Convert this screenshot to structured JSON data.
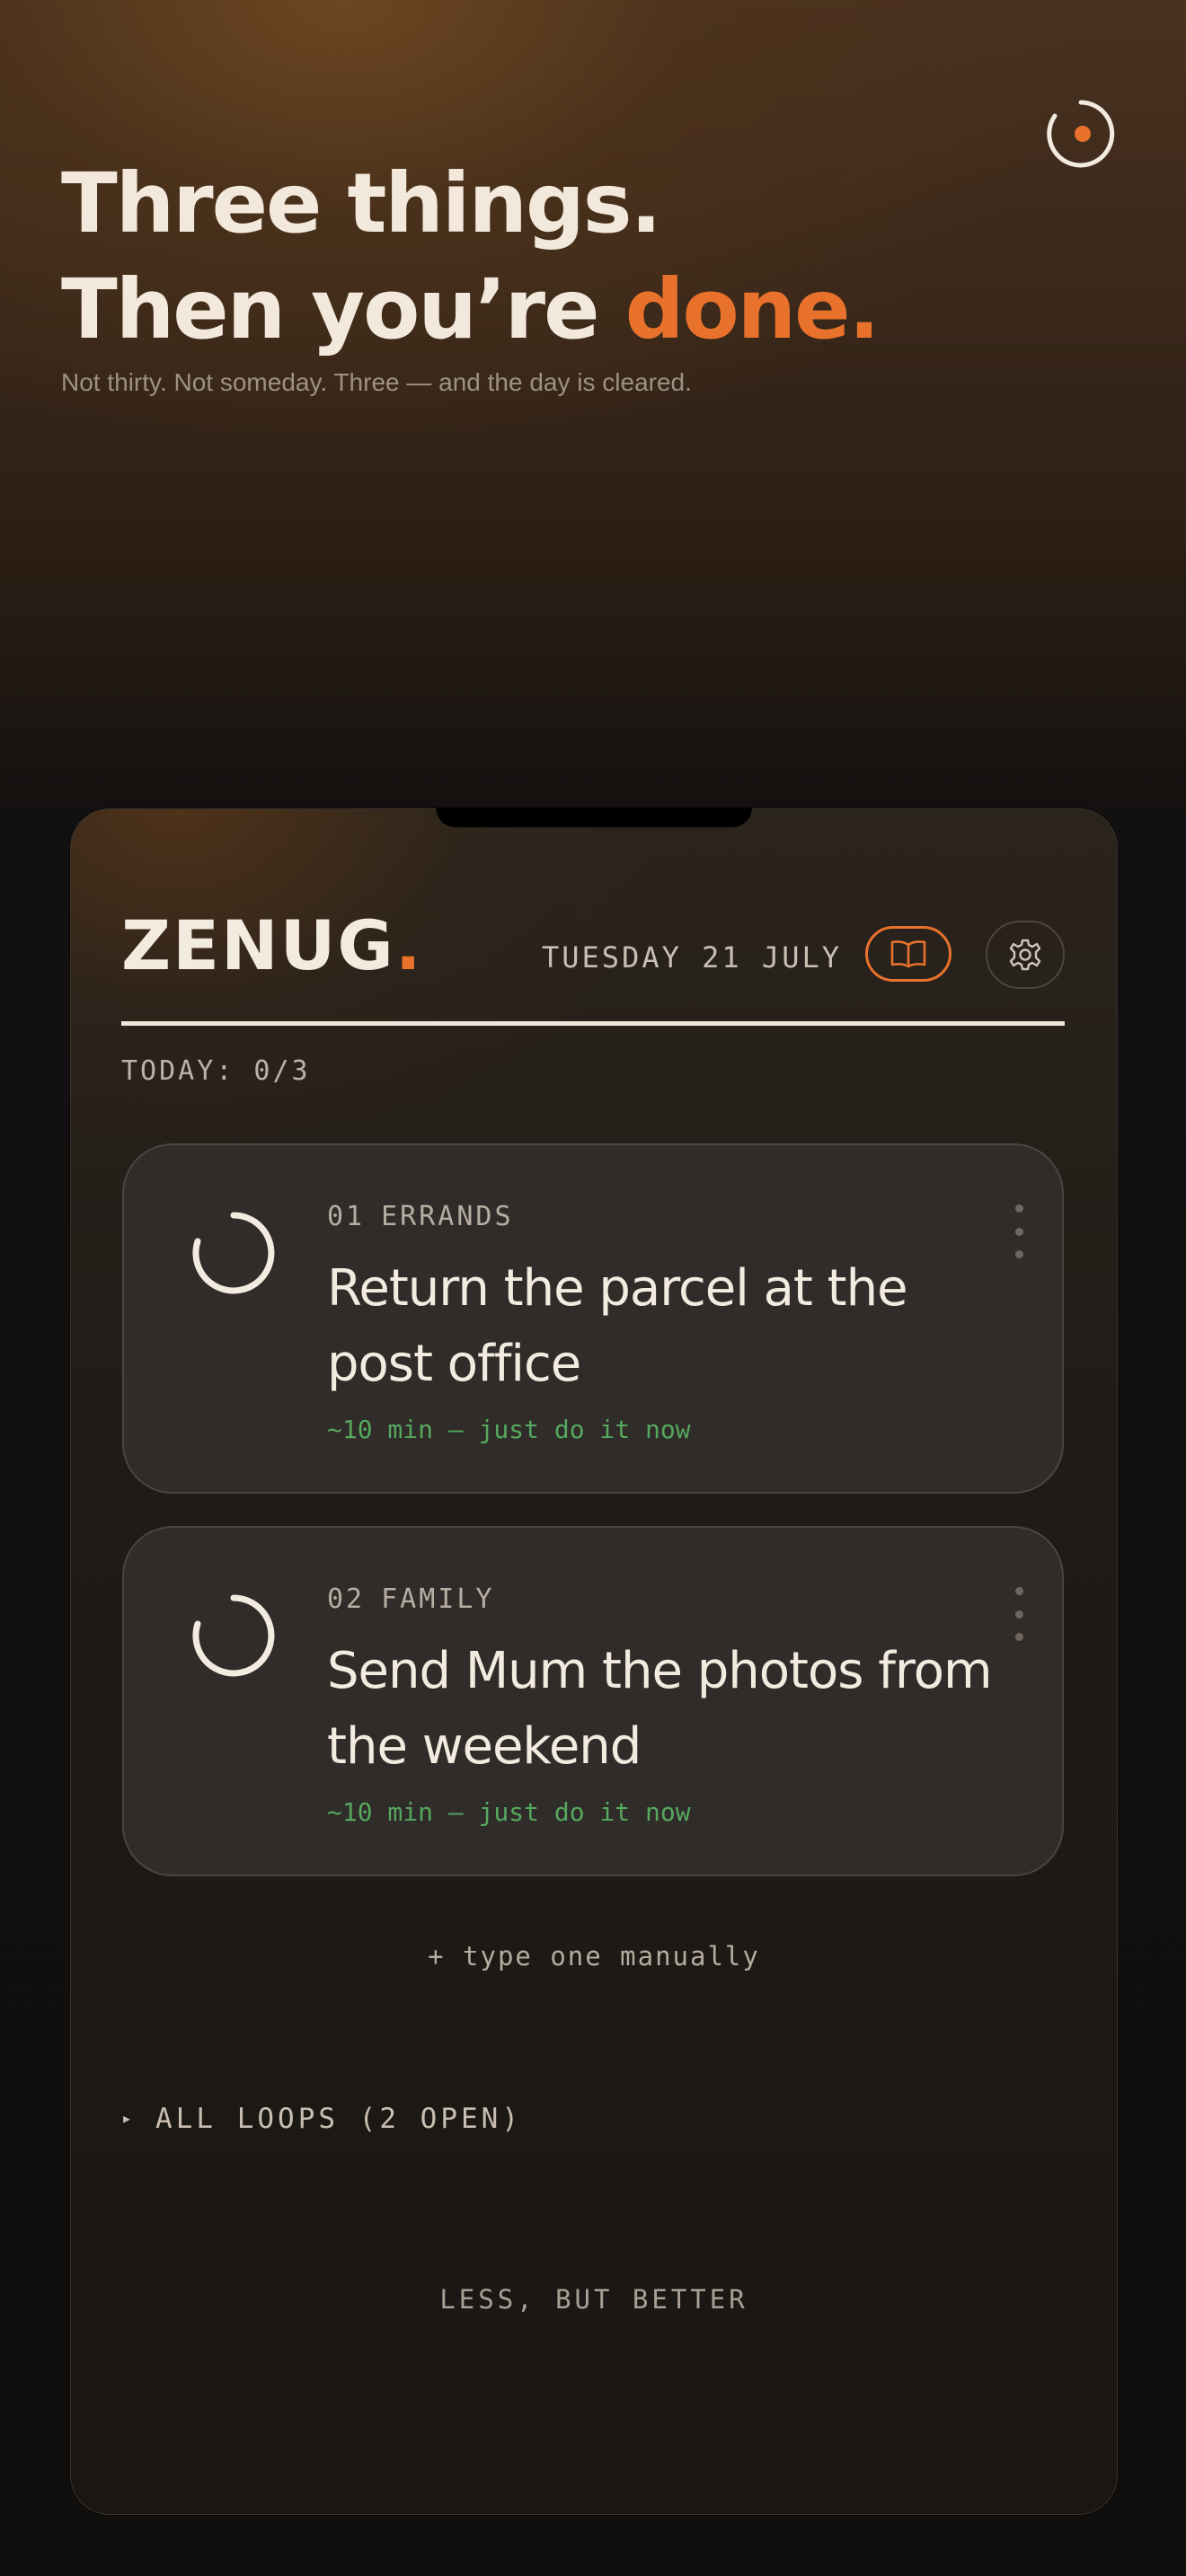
{
  "hero": {
    "line1": "Three things.",
    "line2_prefix": "Then you’re ",
    "line2_accent": "done.",
    "subtitle": "Not thirty. Not someday. Three — and the day is cleared."
  },
  "app": {
    "brand": "ZENUG",
    "brand_dot": ".",
    "date": "TUESDAY 21 JULY",
    "journal_icon": "book-icon",
    "settings_icon": "gear-icon",
    "progress": "TODAY: 0/3"
  },
  "tasks": [
    {
      "number": "01",
      "category": "ERRANDS",
      "title": "Return the parcel at the post office",
      "hint": "~10 min — just do it now"
    },
    {
      "number": "02",
      "category": "FAMILY",
      "title": "Send Mum the photos from the weekend",
      "hint": "~10 min — just do it now"
    }
  ],
  "actions": {
    "manual": "+ type one manually",
    "loops_arrow": "▸",
    "loops": "ALL LOOPS (2 OPEN)"
  },
  "footer": {
    "motto": "LESS, BUT BETTER"
  },
  "colors": {
    "accent": "#e8722c",
    "hint_green": "#56a85e",
    "text_light": "#f3ebe0"
  }
}
